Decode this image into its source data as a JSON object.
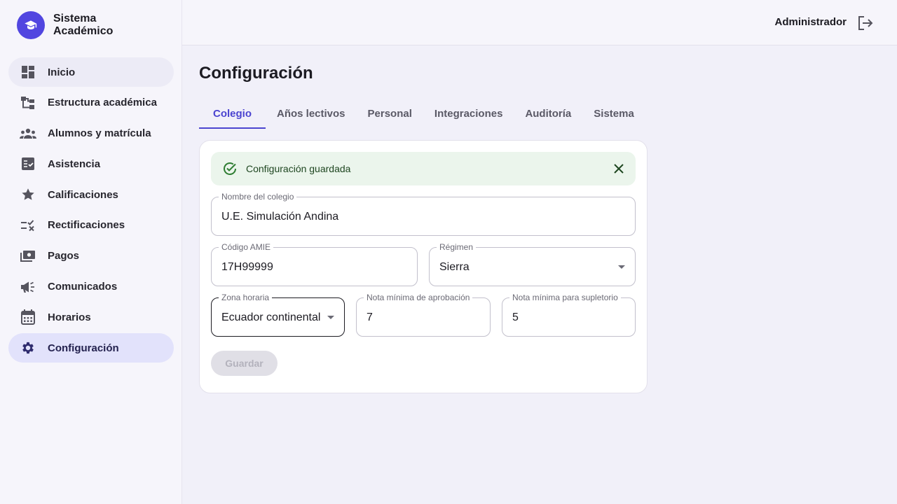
{
  "brand": {
    "title": "Sistema Académico"
  },
  "sidebar": {
    "items": [
      {
        "label": "Inicio",
        "icon": "dashboard-icon"
      },
      {
        "label": "Estructura académica",
        "icon": "hierarchy-icon"
      },
      {
        "label": "Alumnos y matrícula",
        "icon": "people-icon"
      },
      {
        "label": "Asistencia",
        "icon": "checklist-icon"
      },
      {
        "label": "Calificaciones",
        "icon": "star-icon"
      },
      {
        "label": "Rectificaciones",
        "icon": "rule-icon"
      },
      {
        "label": "Pagos",
        "icon": "payments-icon"
      },
      {
        "label": "Comunicados",
        "icon": "megaphone-icon"
      },
      {
        "label": "Horarios",
        "icon": "calendar-icon"
      },
      {
        "label": "Configuración",
        "icon": "gear-icon"
      }
    ],
    "active_index": 9
  },
  "header": {
    "user": "Administrador",
    "logout_icon": "logout-icon"
  },
  "main": {
    "title": "Configuración",
    "tabs": [
      {
        "label": "Colegio"
      },
      {
        "label": "Años lectivos"
      },
      {
        "label": "Personal"
      },
      {
        "label": "Integraciones"
      },
      {
        "label": "Auditoría"
      },
      {
        "label": "Sistema"
      }
    ],
    "active_tab": 0,
    "alert": {
      "message": "Configuración guardada",
      "icon": "check-circle-icon"
    },
    "form": {
      "school_name": {
        "label": "Nombre del colegio",
        "value": "U.E. Simulación Andina"
      },
      "amie_code": {
        "label": "Código AMIE",
        "value": "17H99999"
      },
      "regime": {
        "label": "Régimen",
        "value": "Sierra"
      },
      "timezone": {
        "label": "Zona horaria",
        "value": "Ecuador continental"
      },
      "min_pass_grade": {
        "label": "Nota mínima de aprobación",
        "value": "7"
      },
      "min_supplementary_grade": {
        "label": "Nota mínima para supletorio",
        "value": "5"
      },
      "save_label": "Guardar"
    }
  },
  "colors": {
    "accent": "#4b44d0",
    "brand": "#5146e0",
    "success_bg": "#ebf5ec",
    "success": "#2e7d32"
  }
}
